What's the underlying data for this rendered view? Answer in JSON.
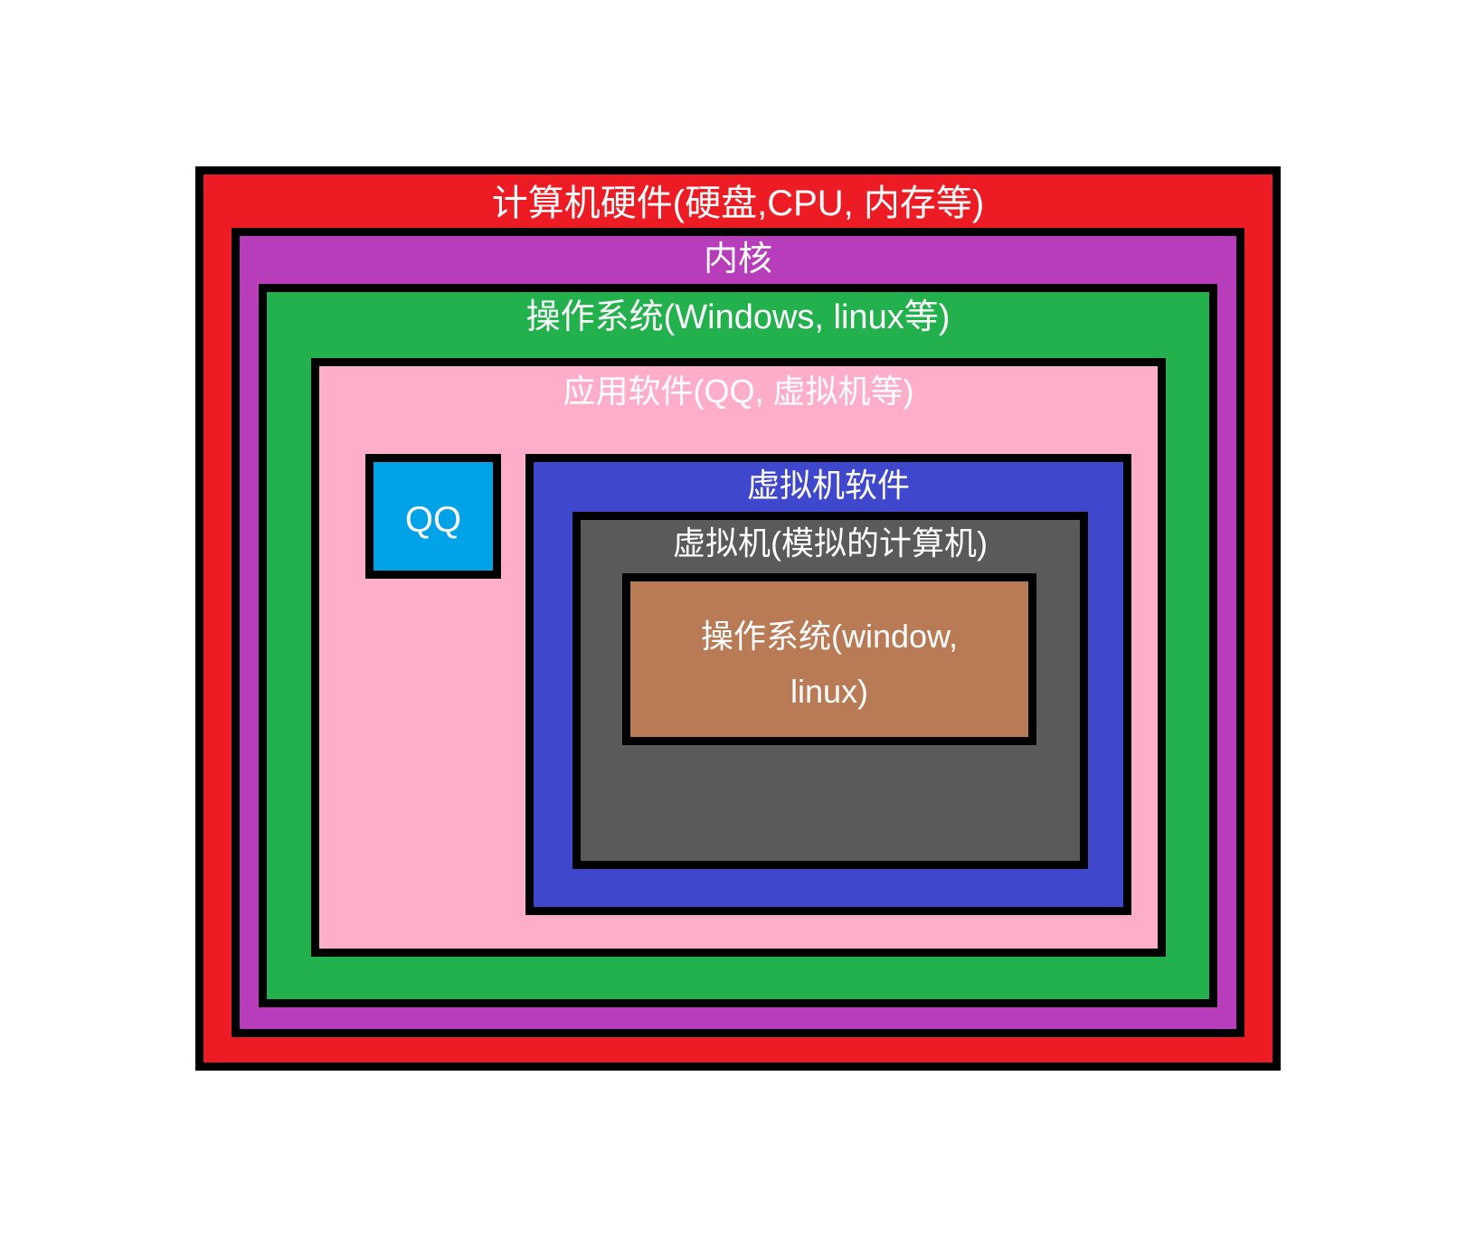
{
  "diagram": {
    "layers": {
      "hardware": {
        "label": "计算机硬件(硬盘,CPU, 内存等)",
        "color": "#ed1c24"
      },
      "kernel": {
        "label": "内核",
        "color": "#b83dba"
      },
      "os": {
        "label": "操作系统(Windows, linux等)",
        "color": "#22b14c"
      },
      "appsoft": {
        "label": "应用软件(QQ, 虚拟机等)",
        "color": "#ffaec9"
      },
      "qq": {
        "label": "QQ",
        "color": "#00a2e8"
      },
      "vmsoft": {
        "label": "虚拟机软件",
        "color": "#3f48cc"
      },
      "vm": {
        "label": "虚拟机(模拟的计算机)",
        "color": "#5a5a5a"
      },
      "inneros": {
        "label": "操作系统(window,\nlinux)",
        "color": "#b97b56"
      }
    }
  }
}
